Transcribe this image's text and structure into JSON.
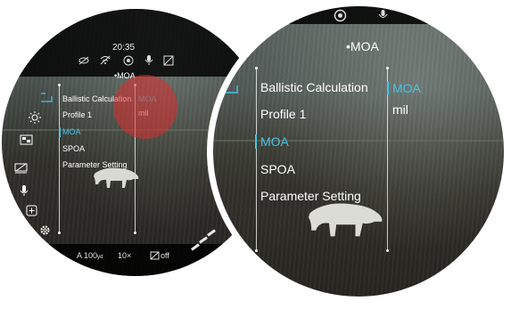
{
  "status": {
    "time": "20:35"
  },
  "header": {
    "title": "MOA"
  },
  "menu": {
    "items": [
      {
        "label": "Ballistic Calculation"
      },
      {
        "label": "Profile 1"
      },
      {
        "label": "MOA",
        "selected": true
      },
      {
        "label": "SPOA"
      },
      {
        "label": "Parameter Setting"
      }
    ]
  },
  "submenu": {
    "options": [
      {
        "label": "MOA",
        "selected": true
      },
      {
        "label": "mil"
      }
    ]
  },
  "bottom_bar": {
    "range_prefix": "A 100",
    "range_unit": "yd",
    "zoom": "10×",
    "pip": "off"
  },
  "sidebar_icons": [
    "exit-icon",
    "brightness-icon",
    "image-mode-icon",
    "display-off-icon",
    "microphone-icon",
    "add-icon",
    "settings-icon"
  ],
  "colors": {
    "accent": "#49c2e6",
    "touch_indicator": "#dc2d2d"
  }
}
